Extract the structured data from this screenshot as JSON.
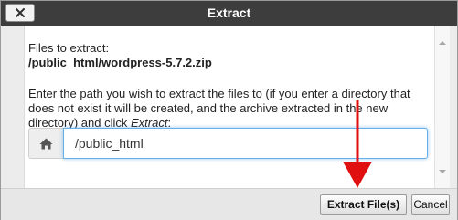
{
  "dialog": {
    "title": "Extract",
    "close_label": "close",
    "files_label": "Files to extract:",
    "file_path": "/public_html/wordpress-5.7.2.zip",
    "instructions_text": "Enter the path you wish to extract the files to (if you enter a directory that does not exist it will be created, and the archive extracted in the new directory) and click ",
    "instructions_emphasis": "Extract",
    "instructions_end": ":",
    "path_value": "/public_html",
    "extract_button": "Extract File(s)",
    "cancel_button": "Cancel"
  },
  "icons": {
    "close": "close-icon",
    "home": "home-icon",
    "annotation": "red-arrow"
  },
  "colors": {
    "titlebar": "#3d3d3d",
    "arrow": "#e01010",
    "input_focus": "#66afe9"
  }
}
